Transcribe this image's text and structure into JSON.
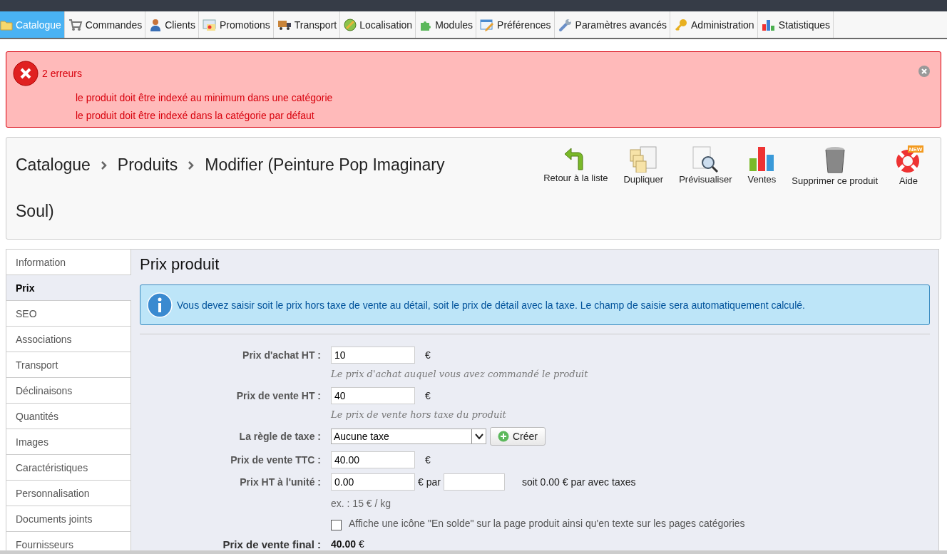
{
  "nav": [
    {
      "label": "Catalogue",
      "selected": true
    },
    {
      "label": "Commandes",
      "selected": false
    },
    {
      "label": "Clients",
      "selected": false
    },
    {
      "label": "Promotions",
      "selected": false
    },
    {
      "label": "Transport",
      "selected": false
    },
    {
      "label": "Localisation",
      "selected": false
    },
    {
      "label": "Modules",
      "selected": false
    },
    {
      "label": "Préférences",
      "selected": false
    },
    {
      "label": "Paramètres avancés",
      "selected": false
    },
    {
      "label": "Administration",
      "selected": false
    },
    {
      "label": "Statistiques",
      "selected": false
    }
  ],
  "errors": {
    "title": "2 erreurs",
    "messages": [
      "le produit doit être indexé au minimum dans une catégorie",
      "le produit doit être indexé dans la catégorie par défaut"
    ]
  },
  "breadcrumb": [
    "Catalogue",
    "Produits",
    "Modifier (Peinture Pop Imaginary Soul)"
  ],
  "toolbar": [
    {
      "label": "Retour à la liste"
    },
    {
      "label": "Dupliquer"
    },
    {
      "label": "Prévisualiser"
    },
    {
      "label": "Ventes"
    },
    {
      "label": "Supprimer ce produit"
    },
    {
      "label": "Aide",
      "badge": "NEW"
    }
  ],
  "sidebar": [
    {
      "label": "Information",
      "selected": false
    },
    {
      "label": "Prix",
      "selected": true
    },
    {
      "label": "SEO",
      "selected": false
    },
    {
      "label": "Associations",
      "selected": false
    },
    {
      "label": "Transport",
      "selected": false
    },
    {
      "label": "Déclinaisons",
      "selected": false
    },
    {
      "label": "Quantités",
      "selected": false
    },
    {
      "label": "Images",
      "selected": false
    },
    {
      "label": "Caractéristiques",
      "selected": false
    },
    {
      "label": "Personnalisation",
      "selected": false
    },
    {
      "label": "Documents joints",
      "selected": false
    },
    {
      "label": "Fournisseurs",
      "selected": false
    }
  ],
  "section": {
    "title": "Prix produit",
    "info": "Vous devez saisir soit le prix hors taxe de vente au détail, soit le prix de détail avec la taxe. Le champ de saisie sera automatiquement calculé.",
    "fields": [
      {
        "kind": "input",
        "label": "Prix d'achat HT :",
        "value": "10",
        "unit": "€",
        "hint": "Le prix d'achat auquel vous avez commandé le produit"
      },
      {
        "kind": "input",
        "label": "Prix de vente HT :",
        "value": "40",
        "unit": "€",
        "hint": "Le prix de vente hors taxe du produit"
      },
      {
        "kind": "select",
        "label": "La règle de taxe :",
        "value": "Aucune taxe",
        "button": "Créer"
      },
      {
        "kind": "input",
        "label": "Prix de vente TTC :",
        "value": "40.00",
        "unit": "€"
      },
      {
        "kind": "unit",
        "label": "Prix HT à l'unité :",
        "value": "0.00",
        "unit": "€ par",
        "summary": "soit 0.00 € par avec taxes",
        "example": "ex. : 15 € / kg"
      },
      {
        "kind": "checkbox",
        "label": "Affiche une icône \"En solde\" sur la page produit ainsi qu'en texte sur les pages catégories",
        "checked": false
      },
      {
        "kind": "final",
        "label": "Prix de vente final :",
        "value": "40.00",
        "unit": "€"
      }
    ]
  }
}
